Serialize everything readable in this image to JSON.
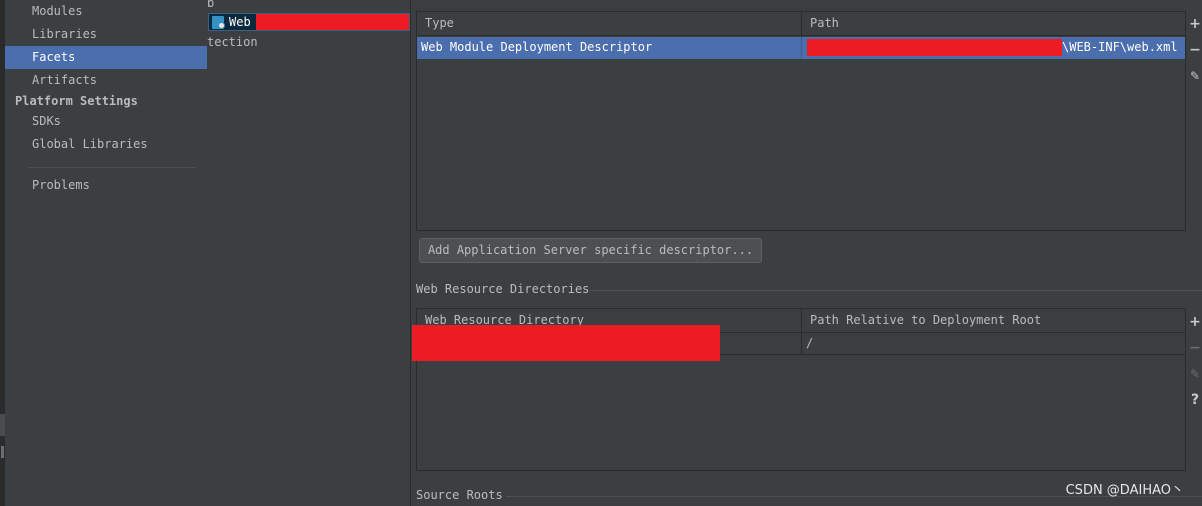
{
  "sidebar": {
    "project_items": [
      {
        "label": "Modules"
      },
      {
        "label": "Libraries"
      },
      {
        "label": "Facets",
        "selected": true
      },
      {
        "label": "Artifacts"
      }
    ],
    "platform_heading": "Platform Settings",
    "platform_items": [
      {
        "label": "SDKs"
      },
      {
        "label": "Global Libraries"
      }
    ],
    "problems_label": "Problems"
  },
  "tree": {
    "cut_top_label": "b",
    "selected_item": {
      "label": "Web",
      "icon": "web-facet-icon"
    },
    "second_label_fragment": "tection"
  },
  "deployment_descriptors": {
    "columns": [
      "Type",
      "Path"
    ],
    "rows": [
      {
        "type": "Web Module Deployment Descriptor",
        "path_suffix": "\\WEB-INF\\web.xml"
      }
    ],
    "add_button_label": "Add Application Server specific descriptor..."
  },
  "toolbar": {
    "add": "+",
    "remove": "−",
    "edit": "✎",
    "help": "?"
  },
  "web_resources": {
    "section_title": "Web Resource Directories",
    "columns": [
      "Web Resource Directory",
      "Path Relative to Deployment Root"
    ],
    "rows": [
      {
        "relative_path": "/"
      }
    ]
  },
  "source_roots": {
    "section_title": "Source Roots"
  },
  "watermark": "CSDN @DAIHAO丶",
  "colors": {
    "background": "#3c3f41",
    "selection": "#4b6eaf",
    "redaction": "#ed1c24",
    "text": "#bbbbbb"
  }
}
